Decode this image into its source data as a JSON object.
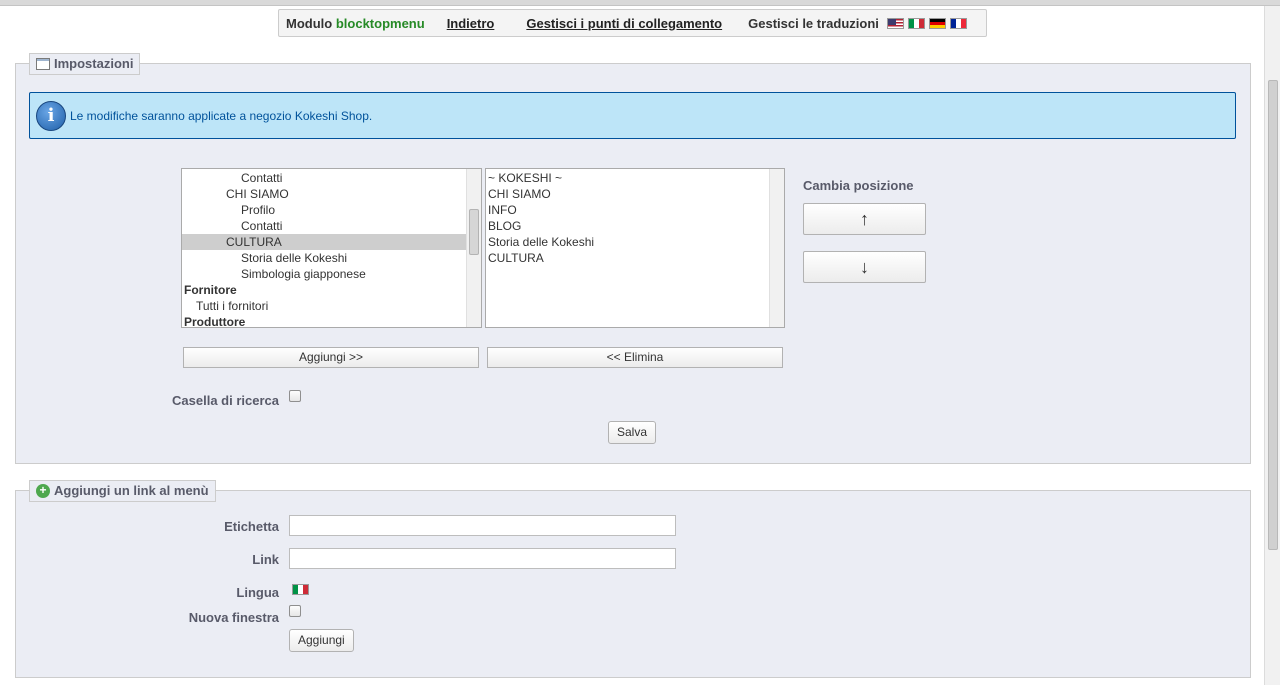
{
  "toolbar": {
    "module_prefix": "Modulo",
    "module_name": "blocktopmenu",
    "back_link": "Indietro",
    "manage_hooks_link": "Gestisci i punti di collegamento",
    "manage_translations": "Gestisci le traduzioni",
    "flags": [
      "en",
      "it",
      "de",
      "fr"
    ]
  },
  "settings": {
    "legend": "Impostazioni",
    "info_message": "Le modifiche saranno applicate a negozio Kokeshi Shop.",
    "available_items": [
      {
        "label": "Contatti",
        "level": 3,
        "selected": false
      },
      {
        "label": "CHI SIAMO",
        "level": 2,
        "selected": false
      },
      {
        "label": "Profilo",
        "level": 3,
        "selected": false
      },
      {
        "label": "Contatti",
        "level": 3,
        "selected": false
      },
      {
        "label": "CULTURA",
        "level": 2,
        "selected": true
      },
      {
        "label": "Storia delle Kokeshi",
        "level": 3,
        "selected": false
      },
      {
        "label": "Simbologia giapponese",
        "level": 3,
        "selected": false
      },
      {
        "label": "Fornitore",
        "level": 0,
        "selected": false
      },
      {
        "label": "Tutti i fornitori",
        "level": 1,
        "selected": false
      },
      {
        "label": "Produttore",
        "level": 0,
        "selected": false
      }
    ],
    "selected_items": [
      "~ KOKESHI ~",
      "CHI SIAMO",
      "INFO",
      "BLOG",
      "Storia delle Kokeshi",
      "CULTURA"
    ],
    "add_button": "Aggiungi >>",
    "remove_button": "<< Elimina",
    "change_position_label": "Cambia posizione",
    "move_up_button": "↑",
    "move_down_button": "↓",
    "search_box_label": "Casella di ricerca",
    "save_button": "Salva"
  },
  "add_link": {
    "legend": "Aggiungi un link al menù",
    "label_field": "Etichetta",
    "label_value": "",
    "link_field": "Link",
    "link_value": "",
    "language_label": "Lingua",
    "language_flag": "it",
    "new_window_label": "Nuova finestra",
    "add_button": "Aggiungi"
  },
  "colors": {
    "panel_bg": "#ebedf4",
    "info_bg": "#bde5f8",
    "info_text": "#00529b",
    "module_name": "#268a26"
  }
}
